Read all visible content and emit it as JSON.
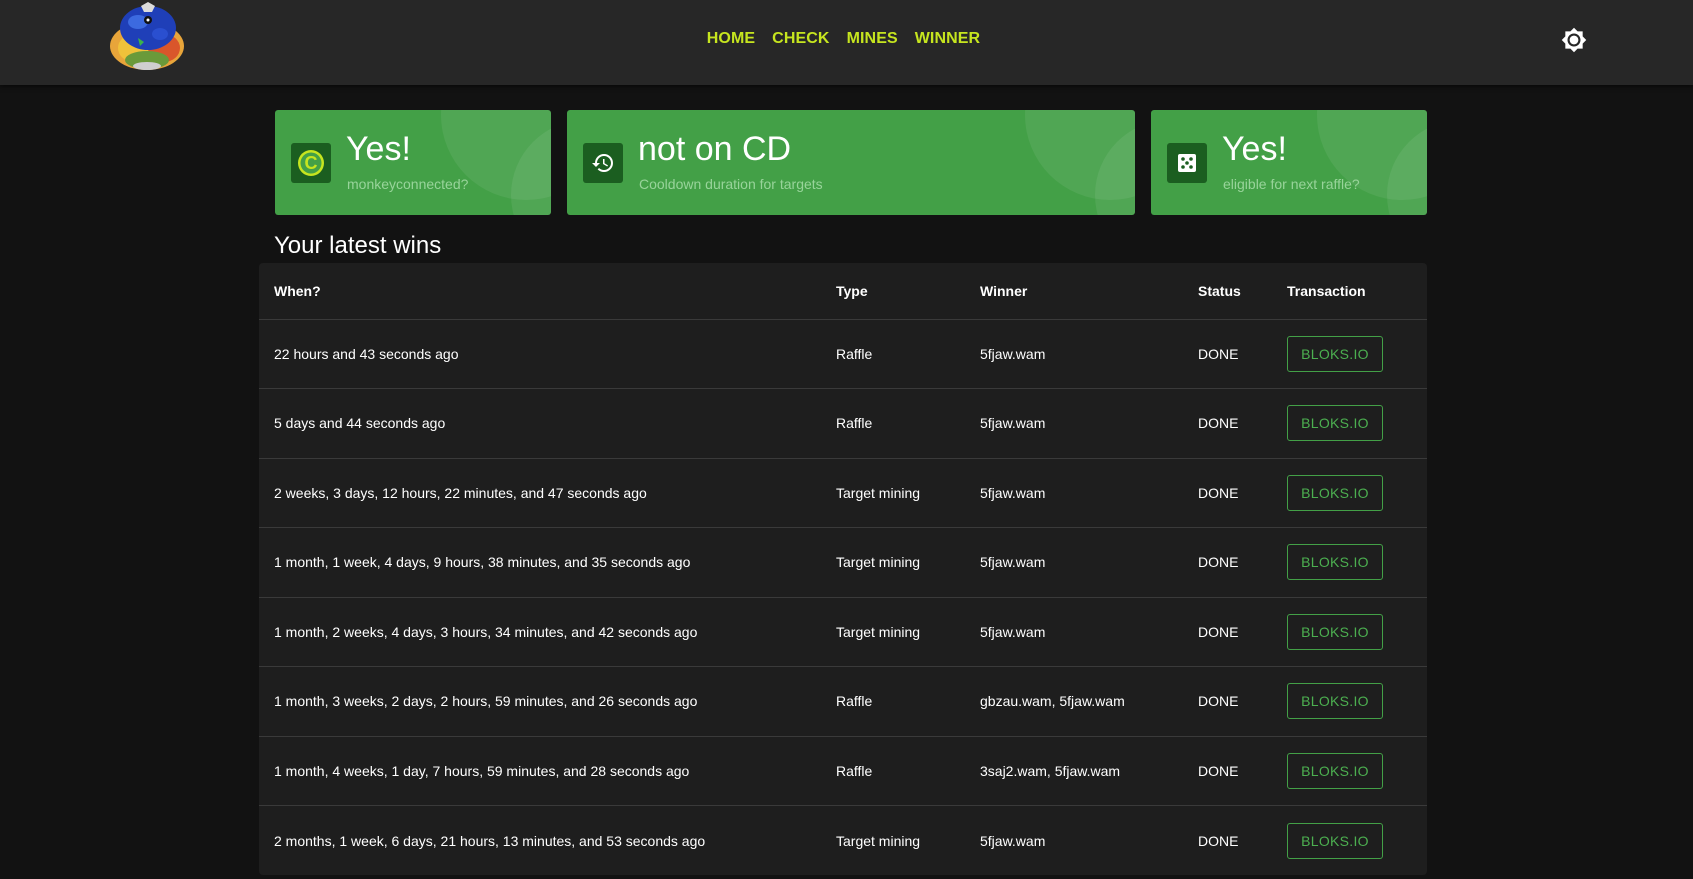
{
  "nav": {
    "items": [
      "HOME",
      "CHECK",
      "MINES",
      "WINNER"
    ]
  },
  "cards": [
    {
      "value": "Yes!",
      "label": "monkeyconnected?",
      "icon": "connected-c-icon"
    },
    {
      "value": "not on CD",
      "label": "Cooldown duration for targets",
      "icon": "history-icon"
    },
    {
      "value": "Yes!",
      "label": "eligible for next raffle?",
      "icon": "dice-icon"
    }
  ],
  "wins": {
    "title": "Your latest wins",
    "headers": [
      "When?",
      "Type",
      "Winner",
      "Status",
      "Transaction"
    ],
    "rows": [
      {
        "when": "22 hours and 43 seconds ago",
        "type": "Raffle",
        "winner": "5fjaw.wam",
        "status": "DONE",
        "tx": "BLOKS.IO"
      },
      {
        "when": "5 days and 44 seconds ago",
        "type": "Raffle",
        "winner": "5fjaw.wam",
        "status": "DONE",
        "tx": "BLOKS.IO"
      },
      {
        "when": "2 weeks, 3 days, 12 hours, 22 minutes, and 47 seconds ago",
        "type": "Target mining",
        "winner": "5fjaw.wam",
        "status": "DONE",
        "tx": "BLOKS.IO"
      },
      {
        "when": "1 month, 1 week, 4 days, 9 hours, 38 minutes, and 35 seconds ago",
        "type": "Target mining",
        "winner": "5fjaw.wam",
        "status": "DONE",
        "tx": "BLOKS.IO"
      },
      {
        "when": "1 month, 2 weeks, 4 days, 3 hours, 34 minutes, and 42 seconds ago",
        "type": "Target mining",
        "winner": "5fjaw.wam",
        "status": "DONE",
        "tx": "BLOKS.IO"
      },
      {
        "when": "1 month, 3 weeks, 2 days, 2 hours, 59 minutes, and 26 seconds ago",
        "type": "Raffle",
        "winner": "gbzau.wam, 5fjaw.wam",
        "status": "DONE",
        "tx": "BLOKS.IO"
      },
      {
        "when": "1 month, 4 weeks, 1 day, 7 hours, 59 minutes, and 28 seconds ago",
        "type": "Raffle",
        "winner": "3saj2.wam, 5fjaw.wam",
        "status": "DONE",
        "tx": "BLOKS.IO"
      },
      {
        "when": "2 months, 1 week, 6 days, 21 hours, 13 minutes, and 53 seconds ago",
        "type": "Target mining",
        "winner": "5fjaw.wam",
        "status": "DONE",
        "tx": "BLOKS.IO"
      }
    ]
  },
  "colors": {
    "accent_green": "#43a047",
    "nav_text": "#c6e51f",
    "background": "#121212",
    "topbar": "#272727"
  }
}
